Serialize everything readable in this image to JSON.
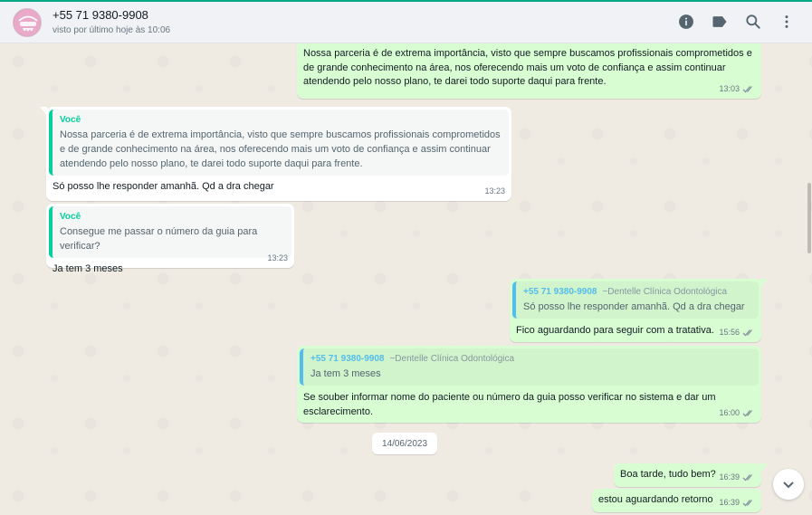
{
  "header": {
    "contact_name": "+55 71 9380-9908",
    "status": "visto por último hoje às 10:06",
    "avatar_label": "Dentelle"
  },
  "icons": {
    "info": "info-icon",
    "label": "label-icon",
    "search": "search-icon",
    "menu": "menu-dots-icon",
    "scroll_down": "chevron-down-icon",
    "read_receipt": "double-check-icon"
  },
  "messages": [
    {
      "direction": "out",
      "text": "Nossa parceria é de extrema importância, visto que sempre buscamos profissionais comprometidos e de grande conhecimento na área, nos oferecendo mais um voto de confiança e assim continuar atendendo pelo nosso plano, te darei todo suporte daqui para frente.",
      "time": "13:03"
    },
    {
      "direction": "in",
      "quote_author": "Você",
      "quote_text": "Nossa parceria é de extrema importância, visto que sempre buscamos profissionais comprometidos e de grande conhecimento na área, nos oferecendo mais um voto de confiança e assim continuar atendendo pelo nosso plano, te darei todo suporte daqui para frente.",
      "text": "Só posso lhe responder amanhã. Qd a dra chegar",
      "time": "13:23"
    },
    {
      "direction": "in",
      "quote_author": "Você",
      "quote_text": "Consegue me passar o número da guia para verificar?",
      "text": "Ja tem 3 meses",
      "time": "13:23"
    },
    {
      "direction": "out",
      "quote_author": "+55 71 9380-9908",
      "quote_sub": "~Dentelle Clínica Odontológica",
      "quote_text": "Só posso lhe responder amanhã. Qd a dra chegar",
      "text": "Fico aguardando para seguir com a tratativa.",
      "time": "15:56"
    },
    {
      "direction": "out",
      "quote_author": "+55 71 9380-9908",
      "quote_sub": "~Dentelle Clínica Odontológica",
      "quote_text": "Ja tem 3 meses",
      "text": "Se souber informar nome do paciente ou número da guia posso verificar no sistema e dar um esclarecimento.",
      "time": "16:00"
    },
    {
      "direction": "out",
      "text": "Boa tarde, tudo bem?",
      "time": "16:39"
    },
    {
      "direction": "out",
      "text": "estou aguardando retorno",
      "time": "16:39"
    }
  ],
  "date_divider": "14/06/2023",
  "colors": {
    "accent": "#00a884",
    "outgoing_bubble": "#d9fdd3",
    "incoming_bubble": "#ffffff",
    "quote_in_bar": "#06cf9c",
    "quote_out_bar": "#53bdeb",
    "chat_background": "#efeae2"
  }
}
